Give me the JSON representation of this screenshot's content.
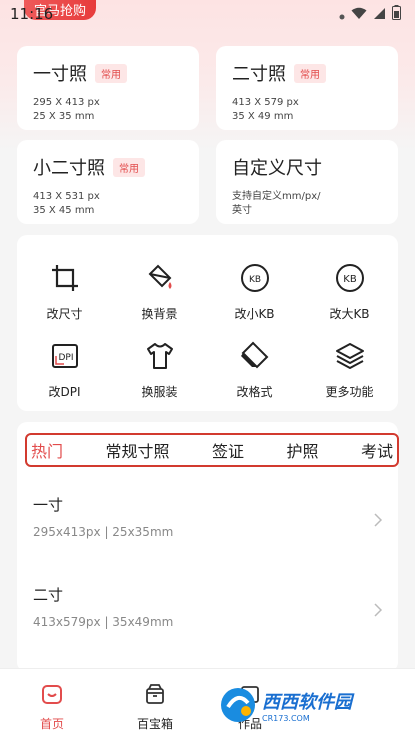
{
  "status_bar": {
    "time": "11:16",
    "promo": "官马抢购"
  },
  "size_cards": [
    {
      "name": "一寸照",
      "tag": "常用",
      "px": "295 X 413 px",
      "mm": "25 X 35 mm"
    },
    {
      "name": "二寸照",
      "tag": "常用",
      "px": "413 X 579 px",
      "mm": "35 X 49 mm"
    },
    {
      "name": "小二寸照",
      "tag": "常用",
      "px": "413 X 531 px",
      "mm": "35 X 45 mm"
    },
    {
      "name": "自定义尺寸",
      "tag": "",
      "px": "支持自定义mm/px/",
      "mm": "英寸"
    }
  ],
  "tools": [
    {
      "label": "改尺寸",
      "icon": "crop-icon"
    },
    {
      "label": "换背景",
      "icon": "paint-bucket-icon"
    },
    {
      "label": "改小KB",
      "icon": "kb-small-icon",
      "badge": "KB"
    },
    {
      "label": "改大KB",
      "icon": "kb-large-icon",
      "badge": "KB"
    },
    {
      "label": "改DPI",
      "icon": "dpi-icon",
      "badge": "DPI"
    },
    {
      "label": "换服装",
      "icon": "shirt-icon"
    },
    {
      "label": "改格式",
      "icon": "eraser-icon"
    },
    {
      "label": "更多功能",
      "icon": "layers-icon"
    }
  ],
  "tabs": [
    "热门",
    "常规寸照",
    "签证",
    "护照",
    "考试"
  ],
  "list": [
    {
      "title": "一寸",
      "sub": "295x413px  |  25x35mm"
    },
    {
      "title": "二寸",
      "sub": "413x579px  |  35x49mm"
    }
  ],
  "bottom_nav": [
    {
      "label": "首页",
      "icon": "home-icon"
    },
    {
      "label": "百宝箱",
      "icon": "box-icon"
    },
    {
      "label": "作品",
      "icon": "works-icon"
    }
  ],
  "watermark": {
    "text": "西西软件园",
    "url": "CR173.COM"
  },
  "colors": {
    "accent": "#e24c4c",
    "highlight_border": "#d23a2f"
  }
}
